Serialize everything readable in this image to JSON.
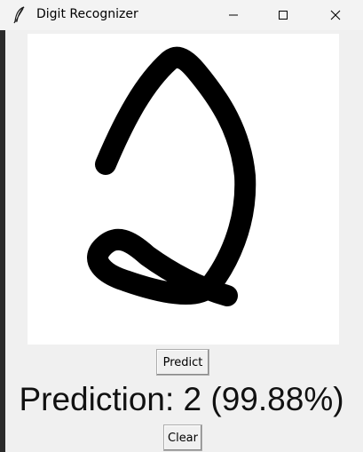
{
  "window": {
    "title": "Digit Recognizer",
    "icon": "feather-icon",
    "controls": {
      "minimize": "minimize-icon",
      "maximize": "maximize-icon",
      "close": "close-icon"
    }
  },
  "canvas": {
    "background": "#ffffff",
    "stroke_color": "#000000",
    "drawn_digit": "2"
  },
  "buttons": {
    "predict_label": "Predict",
    "clear_label": "Clear"
  },
  "result": {
    "text": "Prediction: 2 (99.88%)",
    "digit": 2,
    "confidence_percent": 99.88
  }
}
